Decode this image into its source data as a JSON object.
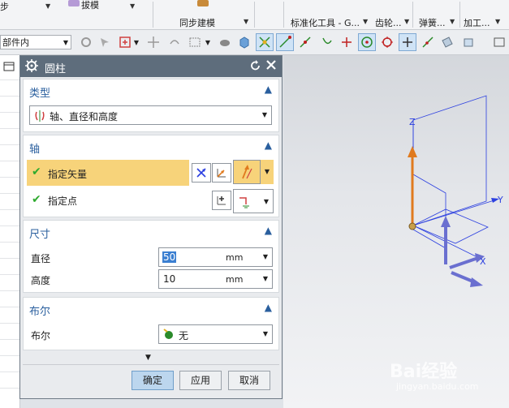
{
  "ribbon": {
    "groups": [
      {
        "label": "同步建模"
      },
      {
        "label": "标准化工具 - G..."
      },
      {
        "label": "齿轮..."
      },
      {
        "label": "弹簧..."
      },
      {
        "label": "加工..."
      }
    ],
    "partial_label": "拔模",
    "left_partial": "步"
  },
  "toolbar": {
    "filter_value": "部件内"
  },
  "dialog": {
    "title": "圆柱",
    "type_section": {
      "heading": "类型",
      "selected": "轴、直径和高度"
    },
    "axis_section": {
      "heading": "轴",
      "specify_vector": "指定矢量",
      "specify_point": "指定点"
    },
    "dimension_section": {
      "heading": "尺寸",
      "diameter_label": "直径",
      "diameter_value": "50",
      "diameter_unit": "mm",
      "height_label": "高度",
      "height_value": "10",
      "height_unit": "mm"
    },
    "boolean_section": {
      "heading": "布尔",
      "label": "布尔",
      "value": "无"
    },
    "buttons": {
      "ok": "确定",
      "apply": "应用",
      "cancel": "取消"
    }
  },
  "viewport": {
    "axis_z": "Z",
    "axis_y": "Y",
    "axis_x": "X"
  },
  "watermark": {
    "text": "Bai经验",
    "url": "jingyan.baidu.com"
  },
  "colors": {
    "dialog_title_bg": "#5e6d7c",
    "section_heading": "#2a5f9e",
    "highlight_row": "#f7d37a",
    "check_green": "#2eaa2e",
    "vector_orange": "#e07a1e",
    "axis_blue": "#2b3fe0"
  }
}
